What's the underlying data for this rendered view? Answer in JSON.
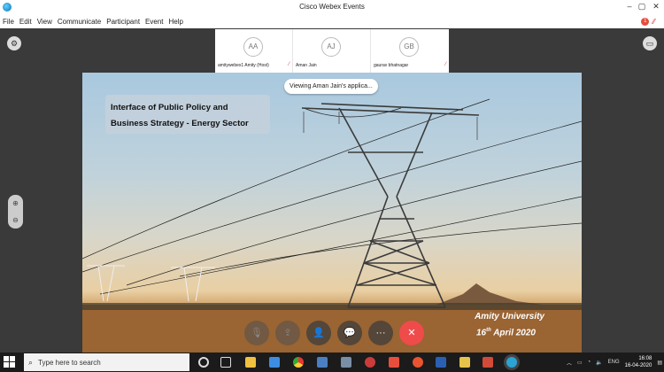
{
  "window": {
    "title": "Cisco Webex Events"
  },
  "menu": [
    "File",
    "Edit",
    "View",
    "Communicate",
    "Participant",
    "Event",
    "Help"
  ],
  "menu_right": {
    "badge_count": "1"
  },
  "participants": [
    {
      "initials": "AA",
      "name": "amitywebex1 Amity (Host)"
    },
    {
      "initials": "AJ",
      "name": "Aman Jain"
    },
    {
      "initials": "GB",
      "name": "gaurav bhatnagar"
    }
  ],
  "sharing_notice": "Viewing Aman Jain's applica...",
  "slide": {
    "title_line1": "Interface of Public Policy and",
    "title_line2": "Business Strategy - Energy Sector",
    "footer_line1": "Amity University",
    "footer_date_day": "16",
    "footer_date_suffix": "th",
    "footer_date_rest": " April 2020"
  },
  "controls": {
    "mute": "mic-icon",
    "share": "share-icon",
    "participants": "participants-icon",
    "chat": "chat-icon",
    "more": "more-icon",
    "end": "end-icon"
  },
  "zoom": {
    "in": "zoom-in-icon",
    "out": "zoom-out-icon"
  },
  "taskbar": {
    "search_placeholder": "Type here to search",
    "language": "ENG",
    "time": "16:08",
    "date": "16-04-2020"
  },
  "colors": {
    "end_call": "#ef4b4b",
    "mute_indicator": "#dd3333"
  }
}
